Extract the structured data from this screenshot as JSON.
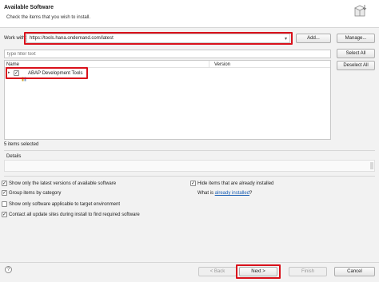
{
  "header": {
    "title": "Available Software",
    "subtitle": "Check the items that you wish to install."
  },
  "work_with": {
    "label": "Work with:",
    "value": "https://tools.hana.ondemand.com/latest",
    "add_label": "Add...",
    "manage_label": "Manage..."
  },
  "filter": {
    "placeholder": "type filter text",
    "select_all_label": "Select All",
    "deselect_all_label": "Deselect All"
  },
  "table": {
    "columns": [
      "Name",
      "Version"
    ],
    "rows": [
      {
        "label": "ABAP Development Tools",
        "checked": true,
        "version": ""
      }
    ]
  },
  "status": {
    "selected_text": "5 items selected"
  },
  "details": {
    "label": "Details"
  },
  "options": {
    "show_latest": "Show only the latest versions of available software",
    "group_by_category": "Group items by category",
    "show_applicable": "Show only software applicable to target environment",
    "contact_sites": "Contact all update sites during install to find required software",
    "hide_installed": "Hide items that are already installed",
    "what_is_prefix": "What is ",
    "already_installed_link": "already installed",
    "what_is_suffix": "?"
  },
  "footer": {
    "help": "?",
    "back_label": "< Back",
    "next_label": "Next >",
    "finish_label": "Finish",
    "cancel_label": "Cancel"
  },
  "colors": {
    "highlight_red": "#d9111b",
    "link_blue": "#1a5fb4"
  }
}
